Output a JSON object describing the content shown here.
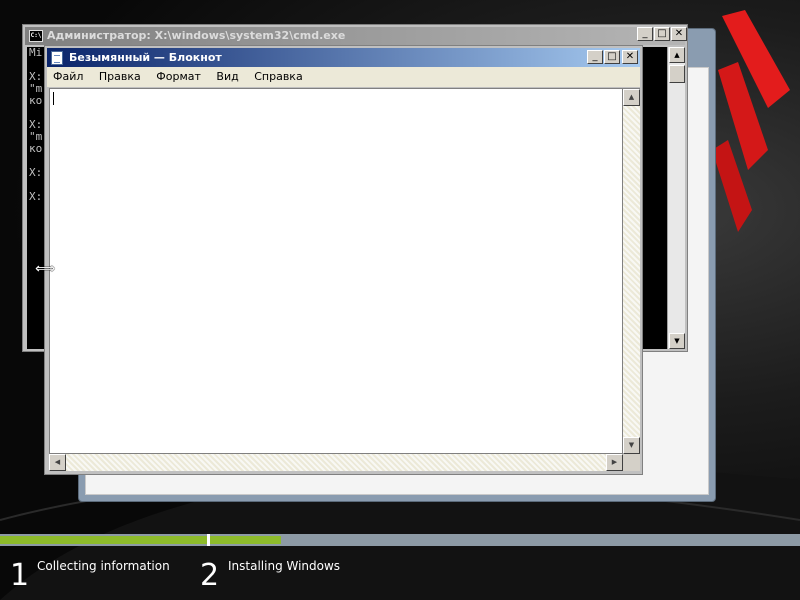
{
  "cmd_window": {
    "title": "Администратор: X:\\windows\\system32\\cmd.exe",
    "icon_text": "C:\\",
    "lines": [
      "Mi",
      "",
      "X:",
      "\"m",
      "ко",
      "",
      "X:",
      "\"m",
      "ко",
      "",
      "X:",
      "",
      "X:"
    ],
    "buttons": {
      "minimize": "_",
      "maximize": "□",
      "close": "✕"
    }
  },
  "notepad": {
    "title": "Безымянный — Блокнот",
    "menu": [
      "Файл",
      "Правка",
      "Формат",
      "Вид",
      "Справка"
    ],
    "content": "",
    "buttons": {
      "minimize": "_",
      "maximize": "□",
      "close": "✕"
    }
  },
  "setup_steps": [
    {
      "number": "1",
      "label": "Collecting information"
    },
    {
      "number": "2",
      "label": "Installing Windows"
    }
  ],
  "progress": {
    "step1_fraction": 1.0,
    "step2_fraction": 0.12
  },
  "colors": {
    "progress_green": "#8dbb2b",
    "accent_red": "#e31c1c",
    "cmd_bg": "#000000"
  },
  "icons": {
    "cursor": "horizontal-resize-icon"
  }
}
